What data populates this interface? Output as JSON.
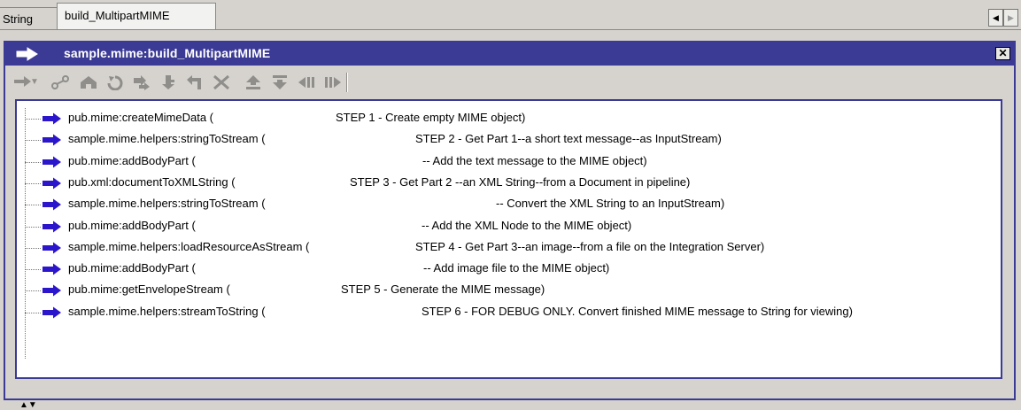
{
  "tabs": {
    "string_label": "String",
    "build_label": "build_MultipartMIME"
  },
  "editor": {
    "title": "sample.mime:build_MultipartMIME",
    "close_label": "✕"
  },
  "toolbar": {
    "buttons": [
      "step-into",
      "dropdown",
      "link",
      "up",
      "refresh",
      "move",
      "down",
      "left",
      "delete",
      "move-up",
      "move-down",
      "indent-left",
      "indent-right"
    ]
  },
  "colors": {
    "frame": "#3b3a95",
    "arrow": "#2b16cc",
    "background": "#d6d3ce"
  },
  "steps": [
    {
      "service": "pub.mime:createMimeData (",
      "comment": "STEP  1 - Create empty MIME object)"
    },
    {
      "service": "sample.mime.helpers:stringToStream (",
      "comment": "STEP  2 - Get Part 1--a short text message--as InputStream)"
    },
    {
      "service": "pub.mime:addBodyPart (",
      "comment": "--  Add the text message to the MIME object)"
    },
    {
      "service": "pub.xml:documentToXMLString (",
      "comment": "STEP  3 - Get Part 2 --an XML String--from a Document in pipeline)"
    },
    {
      "service": "sample.mime.helpers:stringToStream (",
      "comment": "--  Convert the XML String to an InputStream)"
    },
    {
      "service": "pub.mime:addBodyPart (",
      "comment": "-- Add the XML Node to the MIME object)"
    },
    {
      "service": "sample.mime.helpers:loadResourceAsStream (",
      "comment": "STEP 4 - Get Part 3--an image--from a file on the Integration Server)"
    },
    {
      "service": "pub.mime:addBodyPart (",
      "comment": "--  Add image file to the MIME object)"
    },
    {
      "service": "pub.mime:getEnvelopeStream (",
      "comment": "STEP  5 - Generate the MIME message)"
    },
    {
      "service": "sample.mime.helpers:streamToString (",
      "comment": "STEP 6 -  FOR DEBUG ONLY. Convert finished MIME message to String for viewing)"
    }
  ]
}
